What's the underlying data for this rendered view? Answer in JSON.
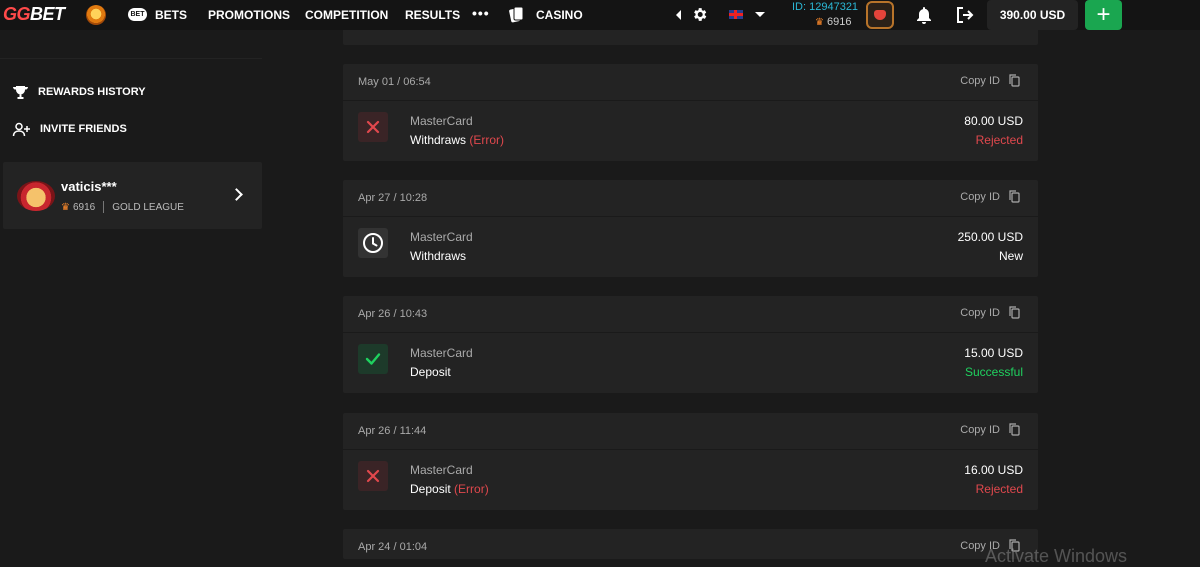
{
  "header": {
    "logo_prefix": "GG",
    "logo_suffix": "BET",
    "bet_pill": "BET",
    "nav": [
      "BETS",
      "PROMOTIONS",
      "COMPETITION",
      "RESULTS"
    ],
    "more": "•••",
    "casino": "CASINO",
    "user_id": "ID: 12947321",
    "user_points": "6916",
    "balance": "390.00 USD",
    "add_label": "+"
  },
  "sidebar": {
    "items": [
      {
        "label": "REWARDS HISTORY",
        "icon": "trophy-icon"
      },
      {
        "label": "INVITE FRIENDS",
        "icon": "add-user-icon"
      }
    ],
    "profile": {
      "name": "vaticis***",
      "points": "6916",
      "league": "GOLD LEAGUE"
    }
  },
  "transactions": [
    {
      "date": "May 01 / 06:54",
      "copy": "Copy ID",
      "method": "MasterCard",
      "type": "Withdraws",
      "note": "(Error)",
      "amount": "80.00 USD",
      "status": "Rejected",
      "state": "error"
    },
    {
      "date": "Apr 27 / 10:28",
      "copy": "Copy ID",
      "method": "MasterCard",
      "type": "Withdraws",
      "note": "",
      "amount": "250.00 USD",
      "status": "New",
      "state": "pending"
    },
    {
      "date": "Apr 26 / 10:43",
      "copy": "Copy ID",
      "method": "MasterCard",
      "type": "Deposit",
      "note": "",
      "amount": "15.00 USD",
      "status": "Successful",
      "state": "success"
    },
    {
      "date": "Apr 26 / 11:44",
      "copy": "Copy ID",
      "method": "MasterCard",
      "type": "Deposit",
      "note": "(Error)",
      "amount": "16.00 USD",
      "status": "Rejected",
      "state": "error"
    },
    {
      "date": "Apr 24 / 01:04",
      "copy": "Copy ID"
    }
  ],
  "watermark": "Activate Windows",
  "colors": {
    "accent_green": "#1aa650",
    "error_red": "#e0484d",
    "success_green": "#1fd15f",
    "id_blue": "#2bb8d6"
  }
}
